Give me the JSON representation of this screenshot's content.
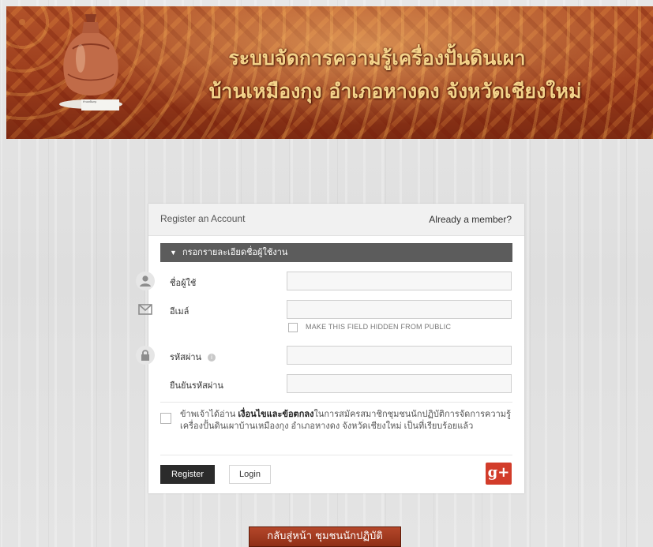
{
  "header": {
    "title_line1": "ระบบจัดการความรู้เครื่องปั้นดินเผา",
    "title_line2": "บ้านเหมืองกุง อำเภอหางดง จังหวัดเชียงใหม่",
    "logo_caption": "บ้านเหมืองกุง"
  },
  "card": {
    "header_left": "Register an Account",
    "header_right": "Already a member?",
    "section_title": "กรอกรายละเอียดชื่อผู้ใช้งาน",
    "fields": {
      "username_label": "ชื่อผู้ใช้",
      "email_label": "อีเมล์",
      "hide_email_label": "MAKE THIS FIELD HIDDEN FROM PUBLIC",
      "password_label": "รหัสผ่าน",
      "confirm_password_label": "ยืนยันรหัสผ่าน",
      "username_value": "",
      "email_value": "",
      "password_value": "",
      "confirm_password_value": ""
    },
    "terms": {
      "prefix": "ข้าพเจ้าได้อ่าน ",
      "link": "เงื่อนไขและข้อตกลง",
      "suffix": "ในการสมัครสมาชิกชุมชนนักปฏิบัติการจัดการความรู้เครื่องปั้นดินเผาบ้านเหมืองกุง อำเภอหางดง จังหวัดเชียงใหม่ เป็นที่เรียบร้อยแล้ว"
    },
    "register_label": "Register",
    "login_label": "Login",
    "gplus_label": "g+"
  },
  "back_button": "กลับสู่หน้า ชุมชนนักปฏิบัติ",
  "colors": {
    "banner": "#9b3c1c",
    "section_bar": "#5c5c5c",
    "register_button": "#2b2b2b",
    "gplus": "#d23c2a",
    "back_button": "#a33c20"
  }
}
